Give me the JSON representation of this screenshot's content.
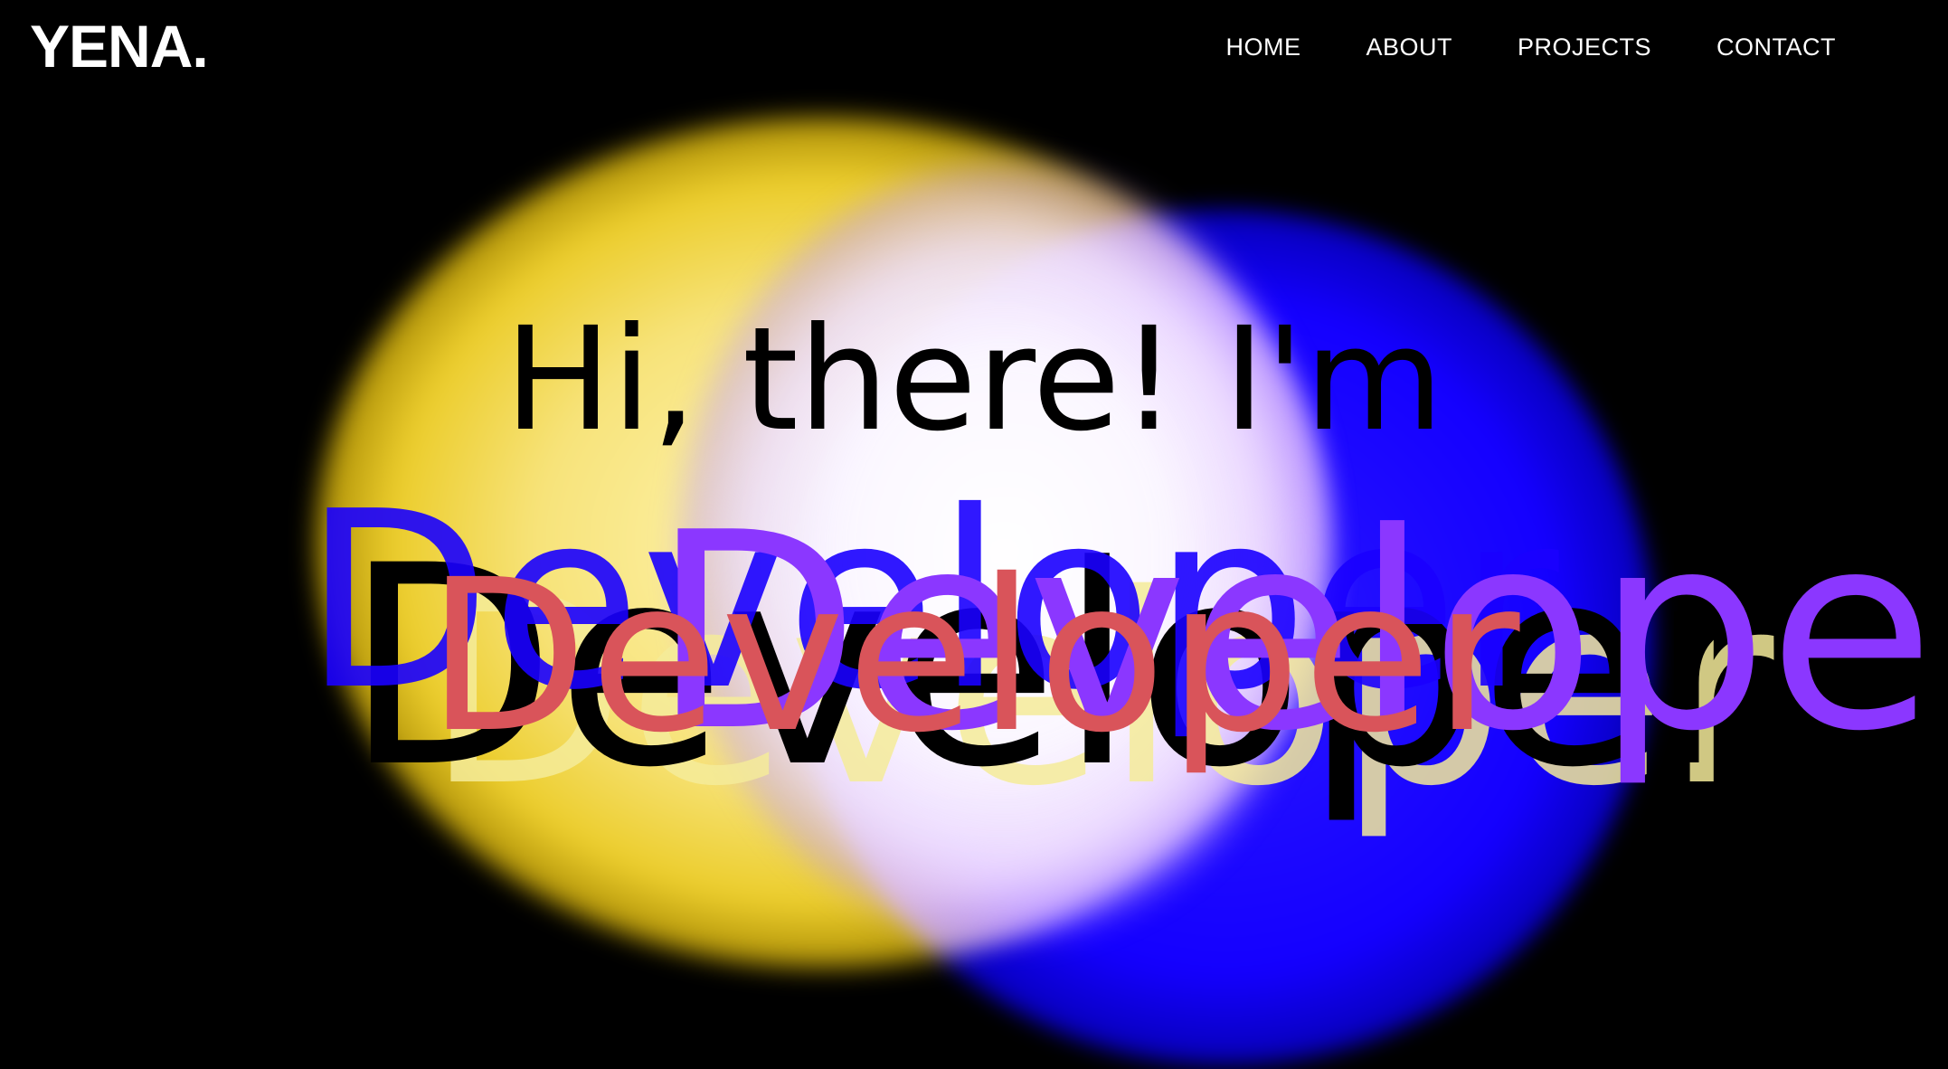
{
  "nav": {
    "logo": "YENA.",
    "links": [
      {
        "label": "HOME"
      },
      {
        "label": "ABOUT"
      },
      {
        "label": "PROJECTS"
      },
      {
        "label": "CONTACT"
      }
    ]
  },
  "hero": {
    "greeting": "Hi, there! I'm",
    "role": "Developer"
  },
  "colors": {
    "background": "#000000",
    "nav_text": "#ffffff",
    "greeting_text": "#000000",
    "role_text": "#d9545a",
    "blob_yellow": "#eccd2c",
    "blob_blue": "#1400ff",
    "blob_violet": "#8b37ff"
  }
}
